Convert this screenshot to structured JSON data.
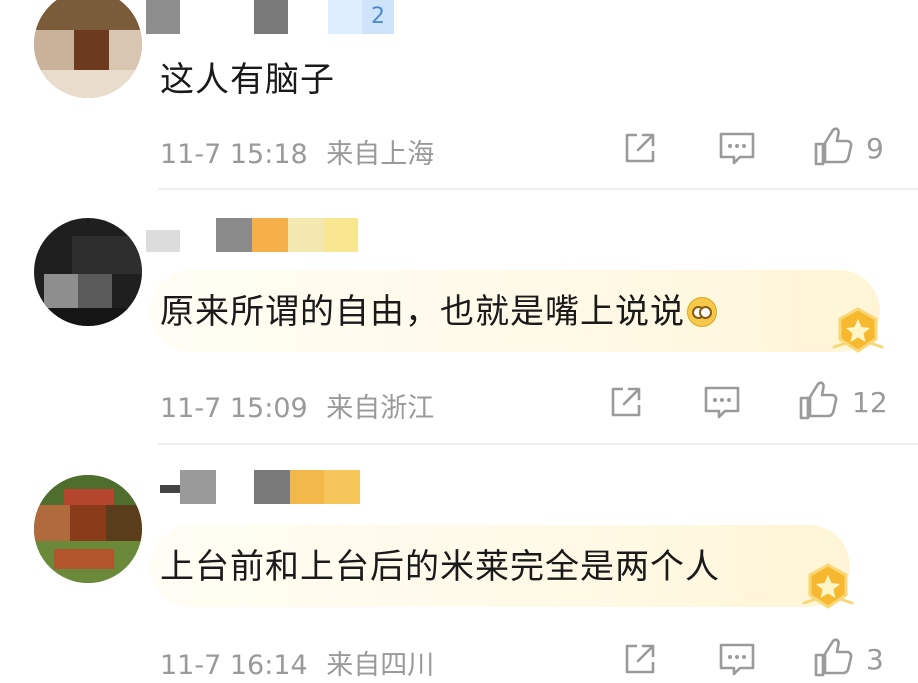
{
  "comments": [
    {
      "text": "这人有脑子",
      "time": "11-7 15:18",
      "location": "来自上海",
      "likes": "9",
      "badge_text": "2",
      "has_badge": false
    },
    {
      "text": "原来所谓的自由，也就是嘴上说说",
      "time": "11-7 15:09",
      "location": "来自浙江",
      "likes": "12",
      "has_badge": true
    },
    {
      "text": "上台前和上台后的米莱完全是两个人",
      "time": "11-7 16:14",
      "location": "来自四川",
      "likes": "3",
      "has_badge": true
    }
  ],
  "icons": {
    "share": "share-icon",
    "comment": "comment-icon",
    "like": "thumbs-up-icon",
    "emoji": "dizzy-face-emoji",
    "badge": "star-badge-icon"
  },
  "colors": {
    "meta_gray": "#9a9a9a",
    "bubble": "#fff9e6",
    "badge_gold": "#f5b82e"
  }
}
